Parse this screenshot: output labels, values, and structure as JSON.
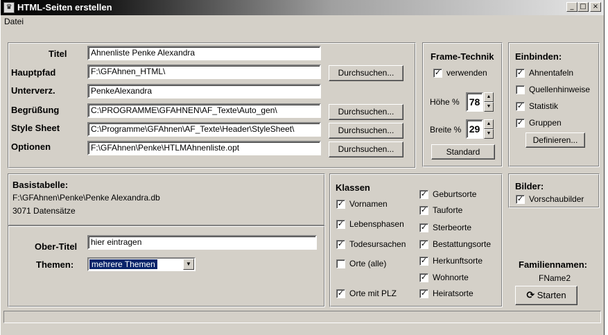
{
  "window": {
    "title": "HTML-Seiten erstellen",
    "buttons": {
      "minimize": "_",
      "maximize": "□",
      "close": "×"
    }
  },
  "menu": {
    "items": [
      "Datei"
    ]
  },
  "paths": {
    "titel_label": "Titel",
    "titel_value": "Ahnenliste Penke Alexandra",
    "hauptpfad_label": "Hauptpfad",
    "hauptpfad_value": "F:\\GFAhnen_HTML\\",
    "unterverz_label": "Unterverz.",
    "unterverz_value": "PenkeAlexandra",
    "begruessung_label": "Begrüßung",
    "begruessung_value": "C:\\PROGRAMME\\GFAHNEN\\AF_Texte\\Auto_gen\\",
    "stylesheet_label": "Style Sheet",
    "stylesheet_value": "C:\\Programme\\GFAhnen\\AF_Texte\\Header\\StyleSheet\\",
    "optionen_label": "Optionen",
    "optionen_value": "F:\\GFAhnen\\Penke\\HTLMAhnenliste.opt",
    "browse_label": "Durchsuchen..."
  },
  "frame": {
    "heading": "Frame-Technik",
    "use_label": "verwenden",
    "use_checked": true,
    "height_label": "Höhe %",
    "height_value": "78",
    "width_label": "Breite %",
    "width_value": "29",
    "standard_label": "Standard"
  },
  "einbinden": {
    "heading": "Einbinden:",
    "items": [
      {
        "label": "Ahnentafeln",
        "checked": true
      },
      {
        "label": "Quellenhinweise",
        "checked": false
      },
      {
        "label": "Statistik",
        "checked": true
      },
      {
        "label": "Gruppen",
        "checked": true
      }
    ],
    "define_label": "Definieren..."
  },
  "basis": {
    "heading": "Basistabelle:",
    "path": "F:\\GFAhnen\\Penke\\Penke Alexandra.db",
    "count": "3071 Datensätze"
  },
  "ober": {
    "label": "Ober-Titel",
    "value": "hier eintragen",
    "themen_label": "Themen:",
    "themen_value": "mehrere Themen"
  },
  "klassen": {
    "heading": "Klassen",
    "col1": [
      {
        "label": "Vornamen",
        "checked": true
      },
      {
        "label": "Lebensphasen",
        "checked": true
      },
      {
        "label": "Todesursachen",
        "checked": true
      },
      {
        "label": "Orte (alle)",
        "checked": false
      },
      {
        "label": "Orte mit PLZ",
        "checked": true
      }
    ],
    "col2": [
      {
        "label": "Geburtsorte",
        "checked": true
      },
      {
        "label": "Tauforte",
        "checked": true
      },
      {
        "label": "Sterbeorte",
        "checked": true
      },
      {
        "label": "Bestattungsorte",
        "checked": true
      },
      {
        "label": "Herkunftsorte",
        "checked": true
      },
      {
        "label": "Wohnorte",
        "checked": true
      },
      {
        "label": "Heiratsorte",
        "checked": true
      }
    ]
  },
  "bilder": {
    "heading": "Bilder:",
    "item": {
      "label": "Vorschaubilder",
      "checked": true
    }
  },
  "familien": {
    "heading": "Familiennamen:",
    "value": "FName2",
    "start_label": "Starten"
  }
}
